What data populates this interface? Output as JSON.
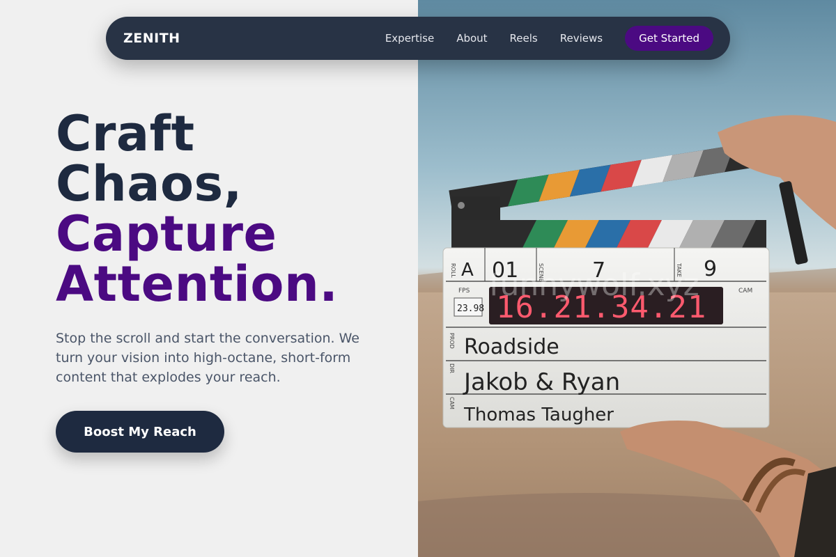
{
  "nav": {
    "brand": "ZENITH",
    "links": [
      "Expertise",
      "About",
      "Reels",
      "Reviews"
    ],
    "cta": "Get Started"
  },
  "hero": {
    "line1": "Craft",
    "line2": "Chaos,",
    "line3": "Capture",
    "line4": "Attention.",
    "subtext": "Stop the scroll and start the conversation. We turn your vision into high-octane, short-form content that explodes your reach.",
    "button": "Boost My Reach"
  },
  "photo": {
    "watermark": "funnywolf.xyz",
    "slate": {
      "roll_label": "ROLL",
      "roll": "A",
      "scene_label": "SCENE",
      "scene": "01",
      "take_label": "TAKE",
      "take_left": "7",
      "take": "9",
      "fps_label": "FPS",
      "fps": "23.98",
      "cam_label": "CAM",
      "timecode": "16.21.34.21",
      "prod_label": "PROD",
      "production": "Roadside",
      "dir_label": "DIR",
      "director": "Jakob & Ryan",
      "cam_row_label": "CAM",
      "camera_op": "Thomas Taugher"
    }
  },
  "colors": {
    "navy": "#1e2a40",
    "nav_bg": "#283345",
    "purple": "#4b0a82",
    "page_bg": "#f0f0f0",
    "timecode_red": "#ff5a6e"
  }
}
